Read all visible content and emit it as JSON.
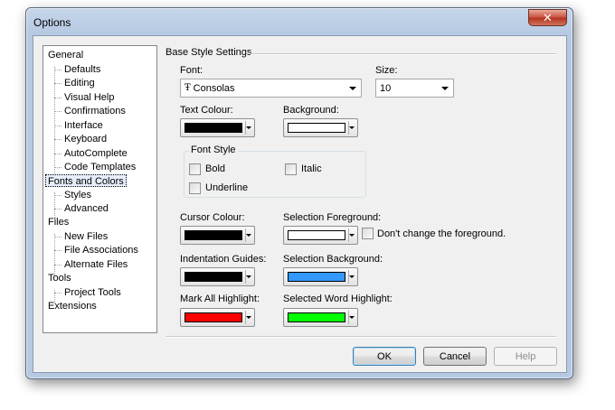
{
  "window": {
    "title": "Options",
    "close_glyph": "✕"
  },
  "tree": {
    "items": [
      {
        "label": "General",
        "level": 0
      },
      {
        "label": "Defaults",
        "level": 1
      },
      {
        "label": "Editing",
        "level": 1
      },
      {
        "label": "Visual Help",
        "level": 1
      },
      {
        "label": "Confirmations",
        "level": 1
      },
      {
        "label": "Interface",
        "level": 1
      },
      {
        "label": "Keyboard",
        "level": 1
      },
      {
        "label": "AutoComplete",
        "level": 1
      },
      {
        "label": "Code Templates",
        "level": 1
      },
      {
        "label": "Fonts and Colors",
        "level": 0,
        "selected": true
      },
      {
        "label": "Styles",
        "level": 1
      },
      {
        "label": "Advanced",
        "level": 1
      },
      {
        "label": "Files",
        "level": 0
      },
      {
        "label": "New Files",
        "level": 1
      },
      {
        "label": "File Associations",
        "level": 1
      },
      {
        "label": "Alternate Files",
        "level": 1
      },
      {
        "label": "Tools",
        "level": 0
      },
      {
        "label": "Project Tools",
        "level": 1
      },
      {
        "label": "Extensions",
        "level": 0
      }
    ]
  },
  "settings": {
    "section_title": "Base Style Settings",
    "font_label": "Font:",
    "font_value": "Consolas",
    "font_glyph": "Ŧ",
    "size_label": "Size:",
    "size_value": "10",
    "text_colour_label": "Text Colour:",
    "background_label": "Background:",
    "font_style_label": "Font Style",
    "bold_label": "Bold",
    "italic_label": "Italic",
    "underline_label": "Underline",
    "cursor_colour_label": "Cursor Colour:",
    "selection_fg_label": "Selection Foreground:",
    "dont_change_fg_label": "Don't change the foreground.",
    "indentation_guides_label": "Indentation Guides:",
    "selection_bg_label": "Selection Background:",
    "mark_all_label": "Mark All Highlight:",
    "selected_word_label": "Selected Word Highlight:"
  },
  "colors": {
    "text_colour": "#000000",
    "background": "#ffffff",
    "cursor_colour": "#000000",
    "selection_foreground": "#ffffff",
    "indentation_guides": "#000000",
    "selection_background": "#3399ff",
    "mark_all_highlight": "#ff0000",
    "selected_word_highlight": "#00ff00"
  },
  "buttons": {
    "ok": "OK",
    "cancel": "Cancel",
    "help": "Help"
  }
}
